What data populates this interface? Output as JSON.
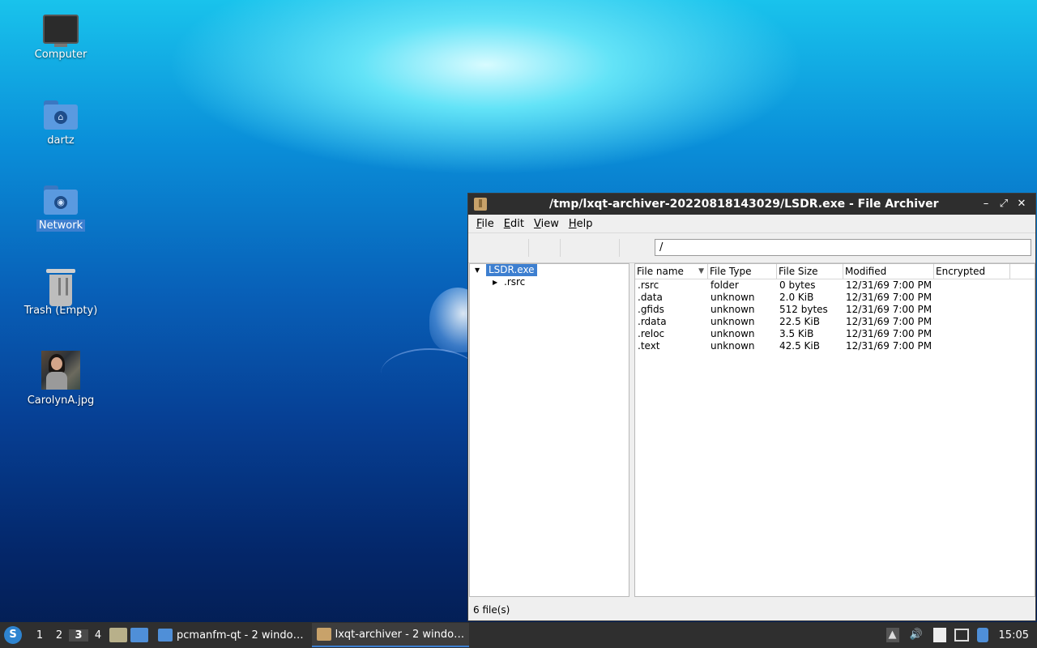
{
  "desktop": {
    "icons": [
      {
        "label": "Computer"
      },
      {
        "label": "dartz"
      },
      {
        "label": "Network"
      },
      {
        "label": "Trash (Empty)"
      },
      {
        "label": "CarolynA.jpg"
      }
    ]
  },
  "window": {
    "title": "/tmp/lxqt-archiver-20220818143029/LSDR.exe - File Archiver",
    "controls": {
      "minimize": "–",
      "maximize": "⤢",
      "close": "✕"
    },
    "menu": [
      "File",
      "Edit",
      "View",
      "Help"
    ],
    "path": "/",
    "tree": [
      {
        "label": "LSDR.exe",
        "expanded": true,
        "selected": true
      },
      {
        "label": ".rsrc",
        "expanded": false,
        "selected": false
      }
    ],
    "columns": [
      "File name",
      "File Type",
      "File Size",
      "Modified",
      "Encrypted"
    ],
    "rows": [
      {
        "name": ".rsrc",
        "type": "folder",
        "size": "0 bytes",
        "modified": "12/31/69 7:00 PM",
        "encrypted": ""
      },
      {
        "name": ".data",
        "type": "unknown",
        "size": "2.0 KiB",
        "modified": "12/31/69 7:00 PM",
        "encrypted": ""
      },
      {
        "name": ".gfids",
        "type": "unknown",
        "size": "512 bytes",
        "modified": "12/31/69 7:00 PM",
        "encrypted": ""
      },
      {
        "name": ".rdata",
        "type": "unknown",
        "size": "22.5 KiB",
        "modified": "12/31/69 7:00 PM",
        "encrypted": ""
      },
      {
        "name": ".reloc",
        "type": "unknown",
        "size": "3.5 KiB",
        "modified": "12/31/69 7:00 PM",
        "encrypted": ""
      },
      {
        "name": ".text",
        "type": "unknown",
        "size": "42.5 KiB",
        "modified": "12/31/69 7:00 PM",
        "encrypted": ""
      }
    ],
    "status": "6 file(s)"
  },
  "taskbar": {
    "workspaces": [
      "1",
      "2",
      "3",
      "4"
    ],
    "active_workspace": "3",
    "tasks": [
      {
        "label": "pcmanfm-qt - 2 windo…",
        "icon": "folder-icon",
        "active": false
      },
      {
        "label": "lxqt-archiver - 2 windo…",
        "icon": "archive-icon",
        "active": true
      }
    ],
    "clock": "15:05"
  },
  "colors": {
    "selection": "#3d7fd0",
    "taskbar": "#2f2f2f",
    "titlebar": "#2e2e2e"
  }
}
